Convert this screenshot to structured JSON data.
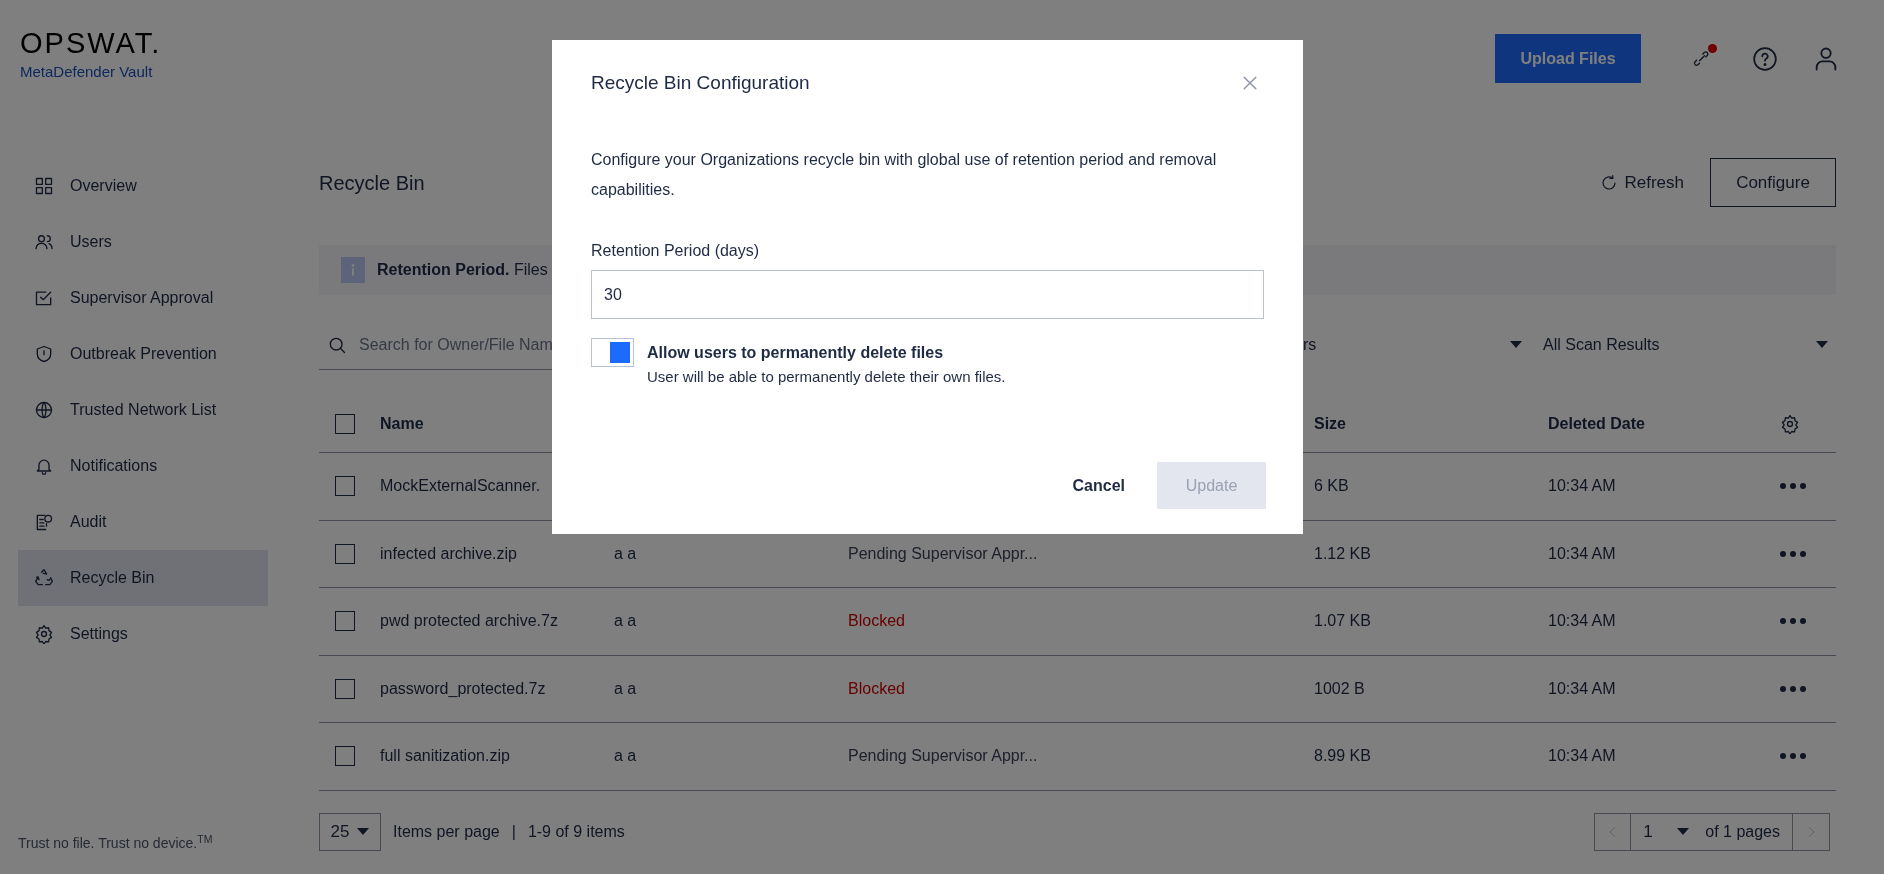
{
  "brand": {
    "logo": "OPSWAT.",
    "product": "MetaDefender Vault"
  },
  "header": {
    "upload_button": "Upload Files",
    "has_notification": true
  },
  "sidebar": {
    "items": [
      {
        "label": "Overview",
        "selected": false
      },
      {
        "label": "Users",
        "selected": false
      },
      {
        "label": "Supervisor Approval",
        "selected": false
      },
      {
        "label": "Outbreak Prevention",
        "selected": false
      },
      {
        "label": "Trusted Network List",
        "selected": false
      },
      {
        "label": "Notifications",
        "selected": false
      },
      {
        "label": "Audit",
        "selected": false
      },
      {
        "label": "Recycle Bin",
        "selected": true
      },
      {
        "label": "Settings",
        "selected": false
      }
    ],
    "tagline": "Trust no file. Trust no device.$^{TM}$"
  },
  "page": {
    "title": "Recycle Bin",
    "refresh": "Refresh",
    "configure": "Configure"
  },
  "banner": {
    "text": "**Retention Period.** Files"
  },
  "search": {
    "placeholder": "Search for Owner/File Nam"
  },
  "filters": [
    {
      "label": "rs"
    },
    {
      "label": "All Scan Results"
    }
  ],
  "table": {
    "all_checked": false,
    "columns": [
      {
        "label": "Name"
      },
      {
        "label": "Size"
      },
      {
        "label": "Deleted Date"
      }
    ],
    "rows": [
      {
        "checked": false,
        "name": "MockExternalScanner.",
        "size": "6 KB",
        "deleted": "10:34 AM"
      },
      {
        "checked": false,
        "name": "infected archive.zip",
        "owner": "a a",
        "status": {
          "text": "Pending Supervisor Appr...",
          "kind": "pending"
        },
        "size": "1.12 KB",
        "deleted": "10:34 AM"
      },
      {
        "checked": false,
        "name": "pwd protected archive.7z",
        "owner": "a a",
        "status": {
          "text": "Blocked",
          "kind": "blocked"
        },
        "size": "1.07 KB",
        "deleted": "10:34 AM"
      },
      {
        "checked": false,
        "name": "password_protected.7z",
        "owner": "a a",
        "status": {
          "text": "Blocked",
          "kind": "blocked"
        },
        "size": "1002 B",
        "deleted": "10:34 AM"
      },
      {
        "checked": false,
        "name": "full sanitization.zip",
        "owner": "a a",
        "status": {
          "text": "Pending Supervisor Appr...",
          "kind": "pending"
        },
        "size": "8.99 KB",
        "deleted": "10:34 AM"
      }
    ]
  },
  "pagination": {
    "page_size": "25",
    "items_label": "Items per page",
    "separator": "|",
    "range": "1-9 of 9 items",
    "page": "1",
    "of_pages": "of 1 pages"
  },
  "modal": {
    "title": "Recycle Bin Configuration",
    "description": "Configure your Organizations recycle bin with global use of retention period and removal capabilities.",
    "field_label": "Retention Period (days)",
    "field_value": "30",
    "toggle": {
      "label": "Allow users to permanently delete files",
      "hint": "User will be able to permanently delete their own files.",
      "on": true
    },
    "cancel": "Cancel",
    "update": {
      "label": "Update",
      "disabled": true
    }
  }
}
